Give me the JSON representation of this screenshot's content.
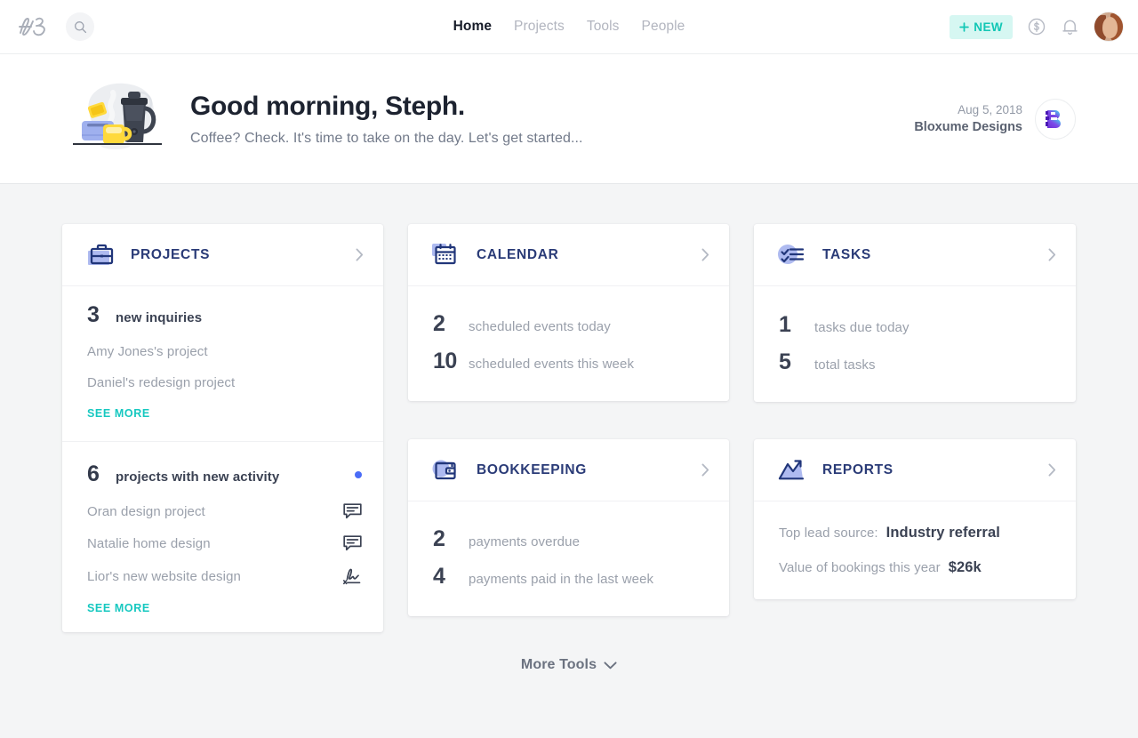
{
  "brand": {
    "logo_text": "HB",
    "accent_teal": "#16c8c0",
    "accent_navy": "#2a3b77",
    "accent_periwinkle": "#9aa9ee"
  },
  "topnav": {
    "search_icon": "search-icon",
    "links": [
      {
        "label": "Home",
        "active": true
      },
      {
        "label": "Projects",
        "active": false
      },
      {
        "label": "Tools",
        "active": false
      },
      {
        "label": "People",
        "active": false
      }
    ],
    "new_button": {
      "label": "NEW",
      "plus": "+"
    },
    "money_icon": "dollar-circle-icon",
    "bell_icon": "notification-bell-icon",
    "avatar": "user-avatar"
  },
  "greeting": {
    "title": "Good morning, Steph.",
    "subtitle": "Coffee? Check. It's time to take on the day. Let's get started...",
    "date": "Aug 5, 2018",
    "company": "Bloxume Designs"
  },
  "cards": {
    "projects": {
      "title": "PROJECTS",
      "inquiries_count": "3",
      "inquiries_label": "new inquiries",
      "inquiries_items": [
        {
          "name": "Amy Jones's project"
        },
        {
          "name": "Daniel's redesign project"
        }
      ],
      "see_more_1": "SEE MORE",
      "activity_count": "6",
      "activity_label": "projects with new activity",
      "activity_items": [
        {
          "name": "Oran design project",
          "icon": "comment-icon"
        },
        {
          "name": "Natalie home design",
          "icon": "comment-icon"
        },
        {
          "name": "Lior's new website design",
          "icon": "signature-icon"
        }
      ],
      "see_more_2": "SEE MORE"
    },
    "calendar": {
      "title": "CALENDAR",
      "stats": [
        {
          "num": "2",
          "label": "scheduled events today"
        },
        {
          "num": "10",
          "label": "scheduled events this week"
        }
      ]
    },
    "tasks": {
      "title": "TASKS",
      "stats": [
        {
          "num": "1",
          "label": "tasks due today"
        },
        {
          "num": "5",
          "label": "total tasks"
        }
      ]
    },
    "bookkeeping": {
      "title": "BOOKKEEPING",
      "stats": [
        {
          "num": "2",
          "label": "payments overdue"
        },
        {
          "num": "4",
          "label": "payments paid in the last week"
        }
      ]
    },
    "reports": {
      "title": "REPORTS",
      "rows": [
        {
          "label": "Top lead source:",
          "value": "Industry referral"
        },
        {
          "label": "Value of bookings this year",
          "value": "$26k"
        }
      ]
    }
  },
  "footer": {
    "more_tools": "More Tools"
  }
}
